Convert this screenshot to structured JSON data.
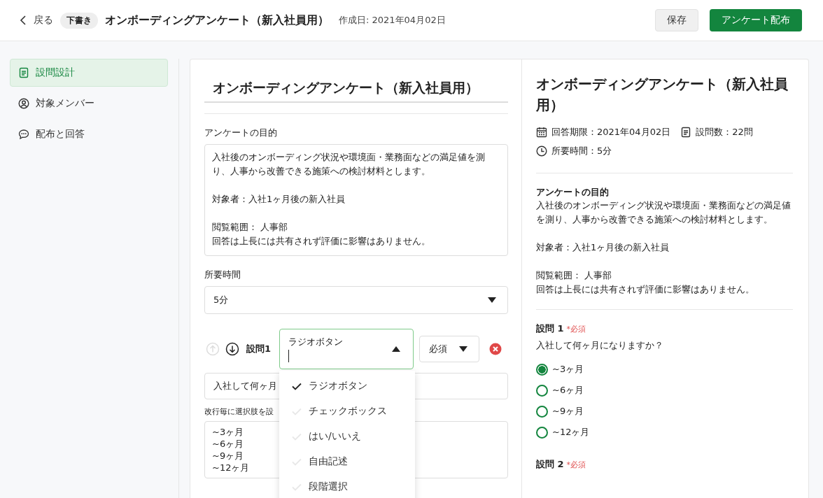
{
  "header": {
    "back": "戻る",
    "status_badge": "下書き",
    "title": "オンボーディングアンケート（新入社員用）",
    "created": "作成日: 2021年04月02日",
    "buttons": [
      {
        "label": "保存",
        "kind": "secondary"
      },
      {
        "label": "アンケート配布",
        "kind": "primary"
      }
    ]
  },
  "sidebar": {
    "items": [
      {
        "label": "設問設計",
        "selected": true
      },
      {
        "label": "対象メンバー",
        "selected": false
      },
      {
        "label": "配布と回答",
        "selected": false
      }
    ]
  },
  "editor": {
    "title": "オンボーディングアンケート（新入社員用）",
    "purpose_label": "アンケートの目的",
    "purpose": [
      [
        "入社後のオンボーディング状況や環境面・業務面などの満足値を測り、人事から改善できる施策への検討材料とします。"
      ],
      [
        "対象者：入社1ヶ月後の新入社員"
      ],
      [
        "閲覧範囲： 人事部",
        "回答は上長には共有されず評価に影響はありません。"
      ]
    ],
    "duration_label": "所要時間",
    "duration": "5分",
    "question": {
      "move_up_disabled": true,
      "label": "設問1",
      "type": "ラジオボタン",
      "type_open": true,
      "required": "必須",
      "text": "入社して何ヶ月",
      "hint": "改行毎に選択肢を設",
      "choices": "~3ヶ月\n~6ヶ月\n~9ヶ月\n~12ヶ月"
    },
    "type_options": [
      {
        "label": "ラジオボタン",
        "selected": true
      },
      {
        "label": "チェックボックス",
        "selected": false
      },
      {
        "label": "はい/いいえ",
        "selected": false
      },
      {
        "label": "自由記述",
        "selected": false
      },
      {
        "label": "段階選択",
        "selected": false
      }
    ]
  },
  "preview": {
    "title": "オンボーディングアンケート（新入社員用）",
    "deadline": "回答期限：2021年04月02日",
    "count": "設問数：22問",
    "duration": "所要時間：5分",
    "purpose_heading": "アンケートの目的",
    "purpose": [
      [
        "入社後のオンボーディング状況や環境面・業務面などの満足値を測り、人事から改善できる施策への検討材料とします。"
      ],
      [
        "対象者：入社1ヶ月後の新入社員"
      ],
      [
        "閲覧範囲： 人事部",
        "回答は上長には共有されず評価に影響はありません。"
      ]
    ],
    "questions": [
      {
        "label": "設問 1",
        "required": "*必須",
        "text": "入社して何ヶ月になりますか？",
        "options": [
          {
            "label": "~3ヶ月",
            "selected": true
          },
          {
            "label": "~6ヶ月",
            "selected": false
          },
          {
            "label": "~9ヶ月",
            "selected": false
          },
          {
            "label": "~12ヶ月",
            "selected": false
          }
        ]
      },
      {
        "label": "設問 2",
        "required": "*必須"
      }
    ]
  }
}
